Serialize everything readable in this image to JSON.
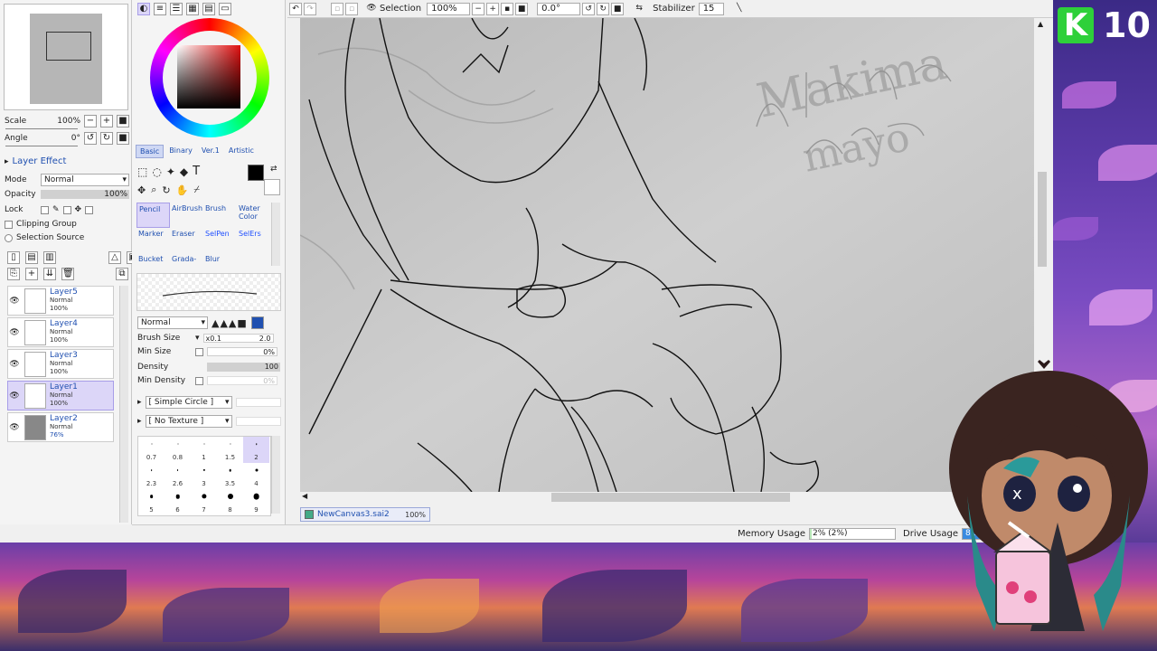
{
  "navigator": {
    "scale_label": "Scale",
    "scale_value": "100%",
    "angle_label": "Angle",
    "angle_value": "0°"
  },
  "layer_panel": {
    "effect_label": "Layer Effect",
    "mode_label": "Mode",
    "mode_value": "Normal",
    "opacity_label": "Opacity",
    "opacity_value": "100%",
    "lock_label": "Lock",
    "clipping_label": "Clipping Group",
    "selection_source_label": "Selection Source",
    "layers": [
      {
        "name": "Layer5",
        "mode": "Normal",
        "opacity": "100%",
        "selected": false,
        "dark": false
      },
      {
        "name": "Layer4",
        "mode": "Normal",
        "opacity": "100%",
        "selected": false,
        "dark": false
      },
      {
        "name": "Layer3",
        "mode": "Normal",
        "opacity": "100%",
        "selected": false,
        "dark": false
      },
      {
        "name": "Layer1",
        "mode": "Normal",
        "opacity": "100%",
        "selected": true,
        "dark": false
      },
      {
        "name": "Layer2",
        "mode": "Normal",
        "opacity": "76%",
        "selected": false,
        "dark": true
      }
    ]
  },
  "tool_panel": {
    "tabs": [
      "Basic",
      "Binary",
      "Ver.1",
      "Artistic"
    ],
    "tools": [
      {
        "label": "Pencil",
        "active": true,
        "blue": false
      },
      {
        "label": "AirBrush",
        "active": false,
        "blue": false
      },
      {
        "label": "Brush",
        "active": false,
        "blue": false
      },
      {
        "label": "Water Color",
        "active": false,
        "blue": false
      },
      {
        "label": "Marker",
        "active": false,
        "blue": false
      },
      {
        "label": "Eraser",
        "active": false,
        "blue": false
      },
      {
        "label": "SelPen",
        "active": false,
        "blue": true
      },
      {
        "label": "SelErs",
        "active": false,
        "blue": true
      },
      {
        "label": "Bucket",
        "active": false,
        "blue": false
      },
      {
        "label": "Grada-",
        "active": false,
        "blue": false
      },
      {
        "label": "Blur",
        "active": false,
        "blue": false
      }
    ],
    "blend_mode": "Normal",
    "brush_size_label": "Brush Size",
    "brush_size_mult": "x0.1",
    "brush_size_value": "2.0",
    "min_size_label": "Min Size",
    "min_size_value": "0%",
    "density_label": "Density",
    "density_value": "100",
    "min_density_label": "Min Density",
    "min_density_value": "0%",
    "shape_label": "[ Simple Circle ]",
    "texture_label": "[ No Texture ]",
    "brush_dots": [
      "0.7",
      "0.8",
      "1",
      "1.5",
      "2",
      "2.3",
      "2.6",
      "3",
      "3.5",
      "4",
      "5",
      "6",
      "7",
      "8",
      "9"
    ]
  },
  "toolbar": {
    "selection_label": "Selection",
    "zoom_value": "100%",
    "rotation_value": "0.0°",
    "stabilizer_label": "Stabilizer",
    "stabilizer_value": "15"
  },
  "document": {
    "name": "NewCanvas3.sai2",
    "zoom": "100%"
  },
  "status": {
    "memory_label": "Memory Usage",
    "memory_value": "2% (2%)",
    "memory_fraction": 0.02,
    "drive_label": "Drive Usage",
    "drive_value": "81"
  },
  "canvas": {
    "sketch_text_1": "Makima",
    "sketch_text_2": "mayo"
  },
  "overlay": {
    "badge_letter": "K",
    "badge_number": "10"
  },
  "colors": {
    "primary": "#000000",
    "secondary": "#ffffff",
    "accent": "#2050b0",
    "selected_bg": "#dcd6f8"
  }
}
